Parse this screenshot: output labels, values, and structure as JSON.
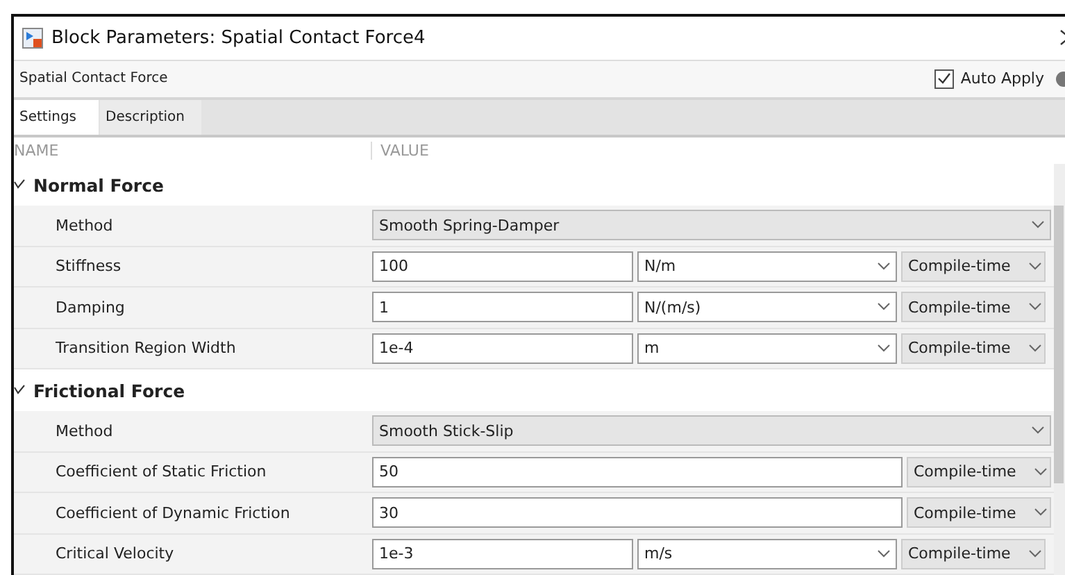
{
  "window": {
    "title": "Block Parameters: Spatial Contact Force4"
  },
  "block_name": "Spatial Contact Force",
  "auto_apply": {
    "label": "Auto Apply",
    "checked": true
  },
  "tabs": [
    {
      "label": "Settings",
      "selected": true
    },
    {
      "label": "Description",
      "selected": false
    }
  ],
  "columns": [
    "NAME",
    "VALUE"
  ],
  "sections": [
    {
      "title": "Normal Force",
      "expanded": true,
      "params": [
        {
          "kind": "dropdown",
          "name": "Method",
          "value": "Smooth Spring-Damper"
        },
        {
          "kind": "unit",
          "name": "Stiffness",
          "value": "100",
          "unit": "N/m",
          "configuration": "Compile-time"
        },
        {
          "kind": "unit",
          "name": "Damping",
          "value": "1",
          "unit": "N/(m/s)",
          "configuration": "Compile-time"
        },
        {
          "kind": "unit",
          "name": "Transition Region Width",
          "value": "1e-4",
          "unit": "m",
          "configuration": "Compile-time"
        }
      ]
    },
    {
      "title": "Frictional Force",
      "expanded": true,
      "params": [
        {
          "kind": "dropdown",
          "name": "Method",
          "value": "Smooth Stick-Slip"
        },
        {
          "kind": "plain",
          "name": "Coefficient of Static Friction",
          "value": "50",
          "configuration": "Compile-time"
        },
        {
          "kind": "plain",
          "name": "Coefficient of Dynamic Friction",
          "value": "30",
          "configuration": "Compile-time"
        },
        {
          "kind": "unit",
          "name": "Critical Velocity",
          "value": "1e-3",
          "unit": "m/s",
          "configuration": "Compile-time"
        }
      ]
    }
  ]
}
